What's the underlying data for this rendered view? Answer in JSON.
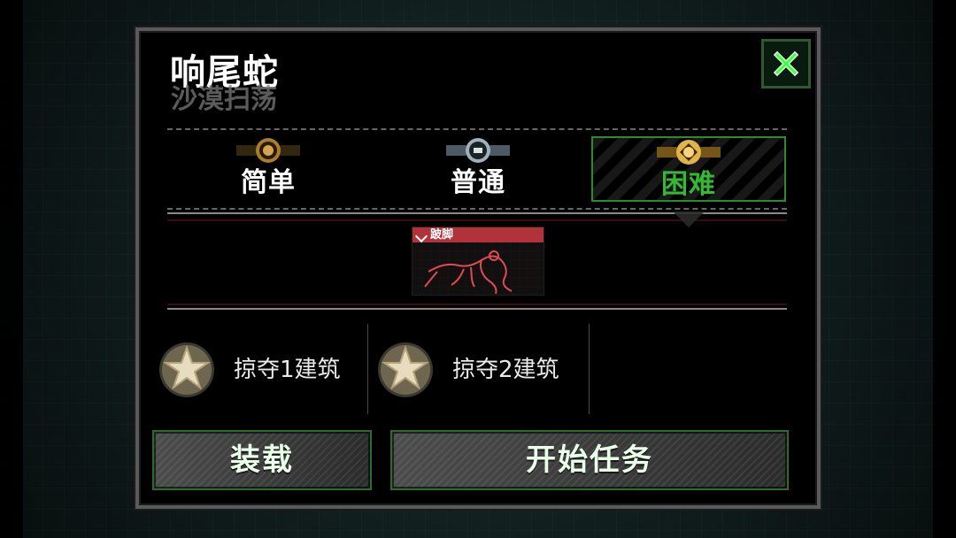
{
  "dialog": {
    "title": "响尾蛇",
    "subtitle": "沙漠扫荡"
  },
  "difficulty": {
    "items": [
      {
        "label": "简单",
        "color": "#ffffff",
        "medal": "bronze-medal-icon"
      },
      {
        "label": "普通",
        "color": "#ffffff",
        "medal": "silver-medal-icon"
      },
      {
        "label": "困难",
        "color": "#35b935",
        "medal": "gold-medal-icon"
      }
    ],
    "selected_label": "困难"
  },
  "tag": {
    "header": "跛脚",
    "icon": "crawler-figure-icon",
    "color": "#b2323a"
  },
  "rewards": [
    {
      "text": "掠夺1建筑",
      "icon": "star-medal-icon"
    },
    {
      "text": "掠夺2建筑",
      "icon": "star-medal-icon"
    }
  ],
  "buttons": {
    "load_label": "装载",
    "start_label": "开始任务"
  },
  "close": {
    "icon": "close-icon",
    "color": "#3cff3c"
  }
}
